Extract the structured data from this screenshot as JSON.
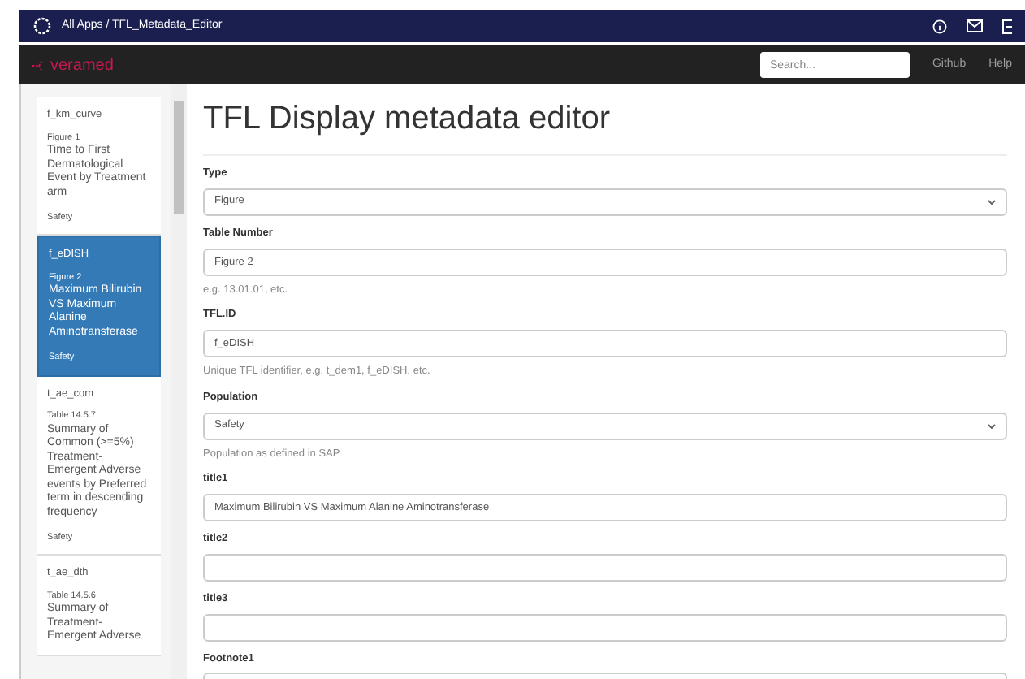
{
  "topbar": {
    "breadcrumb": "All Apps / TFL_Metadata_Editor"
  },
  "navbar": {
    "brand": "veramed",
    "search": {
      "placeholder": "Search..."
    },
    "links": [
      "Github",
      "Help"
    ]
  },
  "sidebar": {
    "items": [
      {
        "id": "f_km_curve",
        "number": "Figure 1",
        "title": "Time to First Dermatological Event by Treatment arm",
        "population": "Safety",
        "selected": false
      },
      {
        "id": "f_eDISH",
        "number": "Figure 2",
        "title": "Maximum Bilirubin VS Maximum Alanine Aminotransferase",
        "population": "Safety",
        "selected": true
      },
      {
        "id": "t_ae_com",
        "number": "Table 14.5.7",
        "title": "Summary of Common (>=5%) Treatment-Emergent Adverse events by Preferred term in descending frequency",
        "population": "Safety",
        "selected": false
      },
      {
        "id": "t_ae_dth",
        "number": "Table 14.5.6",
        "title": "Summary of Treatment-Emergent Adverse",
        "selected": false
      }
    ]
  },
  "main": {
    "heading": "TFL Display metadata editor",
    "fields": [
      {
        "kind": "select",
        "label": "Type",
        "value": "Figure"
      },
      {
        "kind": "input",
        "label": "Table Number",
        "value": "Figure 2",
        "help": "e.g. 13.01.01, etc."
      },
      {
        "kind": "input",
        "label": "TFL.ID",
        "value": "f_eDISH",
        "help": "Unique TFL identifier, e.g. t_dem1, f_eDISH, etc."
      },
      {
        "kind": "select",
        "label": "Population",
        "value": "Safety",
        "help": "Population as defined in SAP"
      },
      {
        "kind": "input",
        "label": "title1",
        "value": "Maximum Bilirubin VS Maximum Alanine Aminotransferase"
      },
      {
        "kind": "input",
        "label": "title2"
      },
      {
        "kind": "input",
        "label": "title3"
      },
      {
        "kind": "input",
        "label": "Footnote1"
      }
    ]
  }
}
